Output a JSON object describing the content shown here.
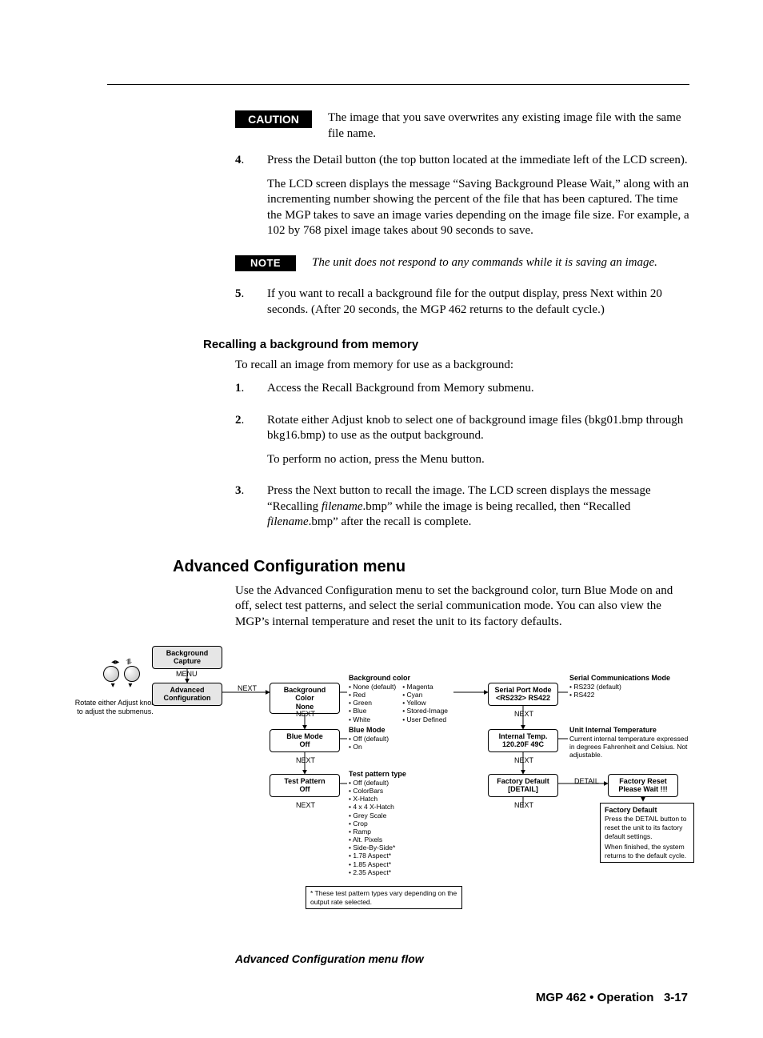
{
  "cautionTag": "CAUTION",
  "noteTag": "NOTE",
  "cautionText": "The image that you save overwrites any existing image file with the same file name.",
  "step4": {
    "num": "4",
    "p1": "Press the Detail button (the top button located at the immediate left of the LCD screen).",
    "p2": "The LCD screen displays the message “Saving Background Please Wait,” along with an incrementing number showing the percent of the file that has been captured.  The time the MGP takes to save an image varies depending on the image file size.  For example, a 102 by 768 pixel image takes about 90 seconds to save."
  },
  "noteText": "The unit does not respond to any commands while it is saving an image.",
  "step5": {
    "num": "5",
    "p1": "If you want to recall a background file for the output display, press Next within 20 seconds.  (After 20 seconds, the MGP 462 returns to the default cycle.)"
  },
  "recallHeading": "Recalling a background from memory",
  "recallIntro": "To recall an image from memory for use as a background:",
  "rstep1": {
    "num": "1",
    "p1": "Access the Recall Background from Memory submenu."
  },
  "rstep2": {
    "num": "2",
    "p1": "Rotate either Adjust knob to select one of background image files (bkg01.bmp through bkg16.bmp) to use as the output background.",
    "p2": "To perform no action, press the Menu button."
  },
  "rstep3": {
    "num": "3",
    "p1a": "Press the Next button to recall the image.  The LCD screen displays the message “Recalling ",
    "p1b": "filename",
    "p1c": ".bmp” while the image is being recalled, then “Recalled ",
    "p1d": "filename",
    "p1e": ".bmp” after the recall is complete."
  },
  "advHeading": "Advanced Configuration menu",
  "advIntro": "Use the Advanced Configuration menu to set the background color, turn Blue Mode on and off, select test patterns, and select the serial communication mode.  You can also view the MGP’s internal temperature and reset the unit to its factory defaults.",
  "figCaption": "Advanced Configuration menu flow",
  "footer": {
    "left": "MGP 462 • Operation",
    "right": "3-17"
  },
  "diagram": {
    "knobNote1": "Rotate either Adjust knob",
    "knobNote2": "to adjust the submenus.",
    "menuLabel": "MENU",
    "nextLabel": "NEXT",
    "detailLabel": "DETAIL",
    "bgCapture1": "Background",
    "bgCapture2": "Capture",
    "advCfg1": "Advanced",
    "advCfg2": "Configuration",
    "bgColor1": "Background Color",
    "bgColor2": "None",
    "blueMode1": "Blue Mode",
    "blueMode2": "Off",
    "testPat1": "Test Pattern",
    "testPat2": "Off",
    "serial1": "Serial Port Mode",
    "serial2": "<RS232>  RS422",
    "intTemp1": "Internal Temp.",
    "intTemp2": "120.20F    49C",
    "factDef1": "Factory Default",
    "factDef2": "[DETAIL]",
    "factReset1": "Factory Reset",
    "factReset2": "Please Wait !!!",
    "side_bgcolor_title": "Background color",
    "side_bgcolor_l": [
      "• None (default)",
      "• Red",
      "• Green",
      "• Blue",
      "• White"
    ],
    "side_bgcolor_r": [
      "• Magenta",
      "• Cyan",
      "• Yellow",
      "• Stored-Image",
      "• User Defined"
    ],
    "side_bluemode_title": "Blue Mode",
    "side_bluemode": [
      "• Off (default)",
      "• On"
    ],
    "side_testpat_title": "Test pattern type",
    "side_testpat": [
      "• Off (default)",
      "• ColorBars",
      "• X-Hatch",
      "• 4 x 4 X-Hatch",
      "• Grey Scale",
      "• Crop",
      "• Ramp",
      "• Alt. Pixels",
      "• Side-By-Side*",
      "• 1.78 Aspect*",
      "• 1.85 Aspect*",
      "• 2.35 Aspect*"
    ],
    "side_testpat_foot1": "* These test pattern types vary depending on the",
    "side_testpat_foot2": "output rate selected.",
    "side_serial_title": "Serial Communications Mode",
    "side_serial": [
      "• RS232 (default)",
      "• RS422"
    ],
    "side_temp_title": "Unit Internal Temperature",
    "side_temp": "Current internal temperature expressed in degrees Fahrenheit and Celsius.  Not adjustable.",
    "side_factdef_title": "Factory Default",
    "side_factdef1": "Press the DETAIL button to reset the unit to its factory default settings.",
    "side_factdef2": "When finished, the system returns to the default cycle."
  }
}
